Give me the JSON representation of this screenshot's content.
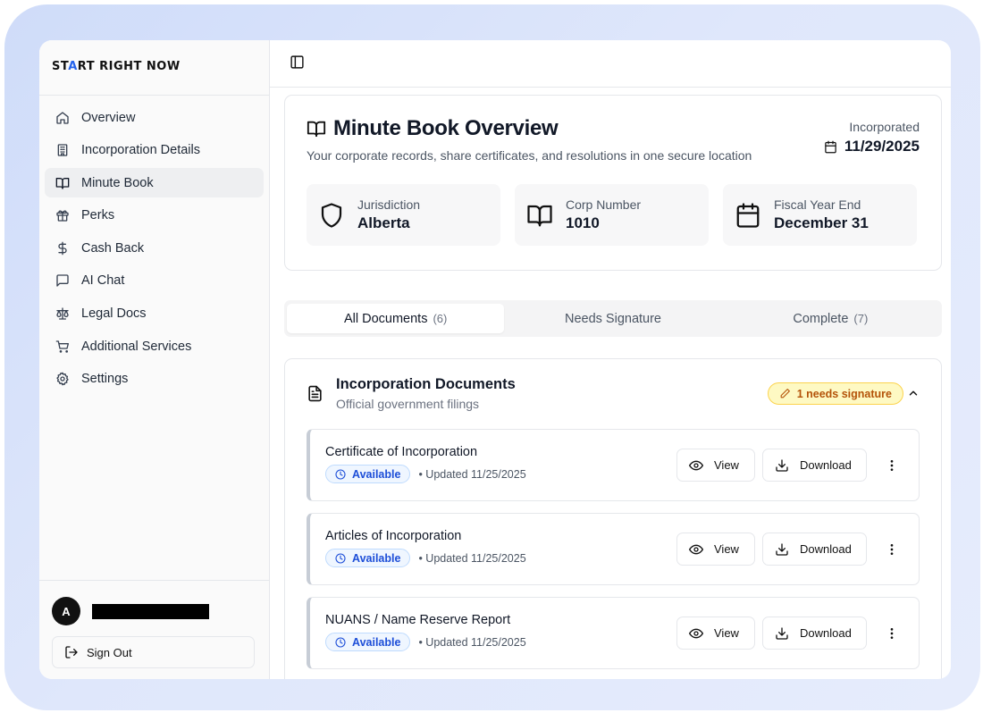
{
  "brand": {
    "part1": "ST",
    "accent": "A",
    "part2": "RT RIGHT NOW"
  },
  "sidebar": {
    "items": [
      {
        "label": "Overview",
        "icon": "home-icon"
      },
      {
        "label": "Incorporation Details",
        "icon": "building-icon"
      },
      {
        "label": "Minute Book",
        "icon": "book-open-icon"
      },
      {
        "label": "Perks",
        "icon": "gift-icon"
      },
      {
        "label": "Cash Back",
        "icon": "dollar-icon"
      },
      {
        "label": "AI Chat",
        "icon": "chat-icon"
      },
      {
        "label": "Legal Docs",
        "icon": "scale-icon"
      },
      {
        "label": "Additional Services",
        "icon": "cart-icon"
      },
      {
        "label": "Settings",
        "icon": "gear-icon"
      }
    ],
    "active_index": 2,
    "user": {
      "avatar_letter": "A"
    },
    "sign_out_label": "Sign Out"
  },
  "overview": {
    "title": "Minute Book Overview",
    "subtitle": "Your corporate records, share certificates, and resolutions in one secure location",
    "incorporated_label": "Incorporated",
    "incorporated_date": "11/29/2025",
    "stats": [
      {
        "label": "Jurisdiction",
        "value": "Alberta",
        "icon": "shield-icon"
      },
      {
        "label": "Corp Number",
        "value": "1010",
        "icon": "book-open-icon"
      },
      {
        "label": "Fiscal Year End",
        "value": "December 31",
        "icon": "calendar-icon"
      }
    ]
  },
  "tabs": [
    {
      "label": "All Documents",
      "count": "(6)"
    },
    {
      "label": "Needs Signature",
      "count": ""
    },
    {
      "label": "Complete",
      "count": "(7)"
    }
  ],
  "documents": {
    "title": "Incorporation Documents",
    "subtitle": "Official government filings",
    "needs_badge": "1 needs signature",
    "view_label": "View",
    "download_label": "Download",
    "rows": [
      {
        "name": "Certificate of Incorporation",
        "status": "Available",
        "updated": "• Updated 11/25/2025"
      },
      {
        "name": "Articles of Incorporation",
        "status": "Available",
        "updated": "• Updated 11/25/2025"
      },
      {
        "name": "NUANS / Name Reserve Report",
        "status": "Available",
        "updated": "• Updated 11/25/2025"
      }
    ]
  },
  "colors": {
    "accent": "#2563eb",
    "badge_warning_bg": "#fef9c3",
    "badge_warning_text": "#b45309",
    "badge_info_text": "#1d4ed8"
  }
}
